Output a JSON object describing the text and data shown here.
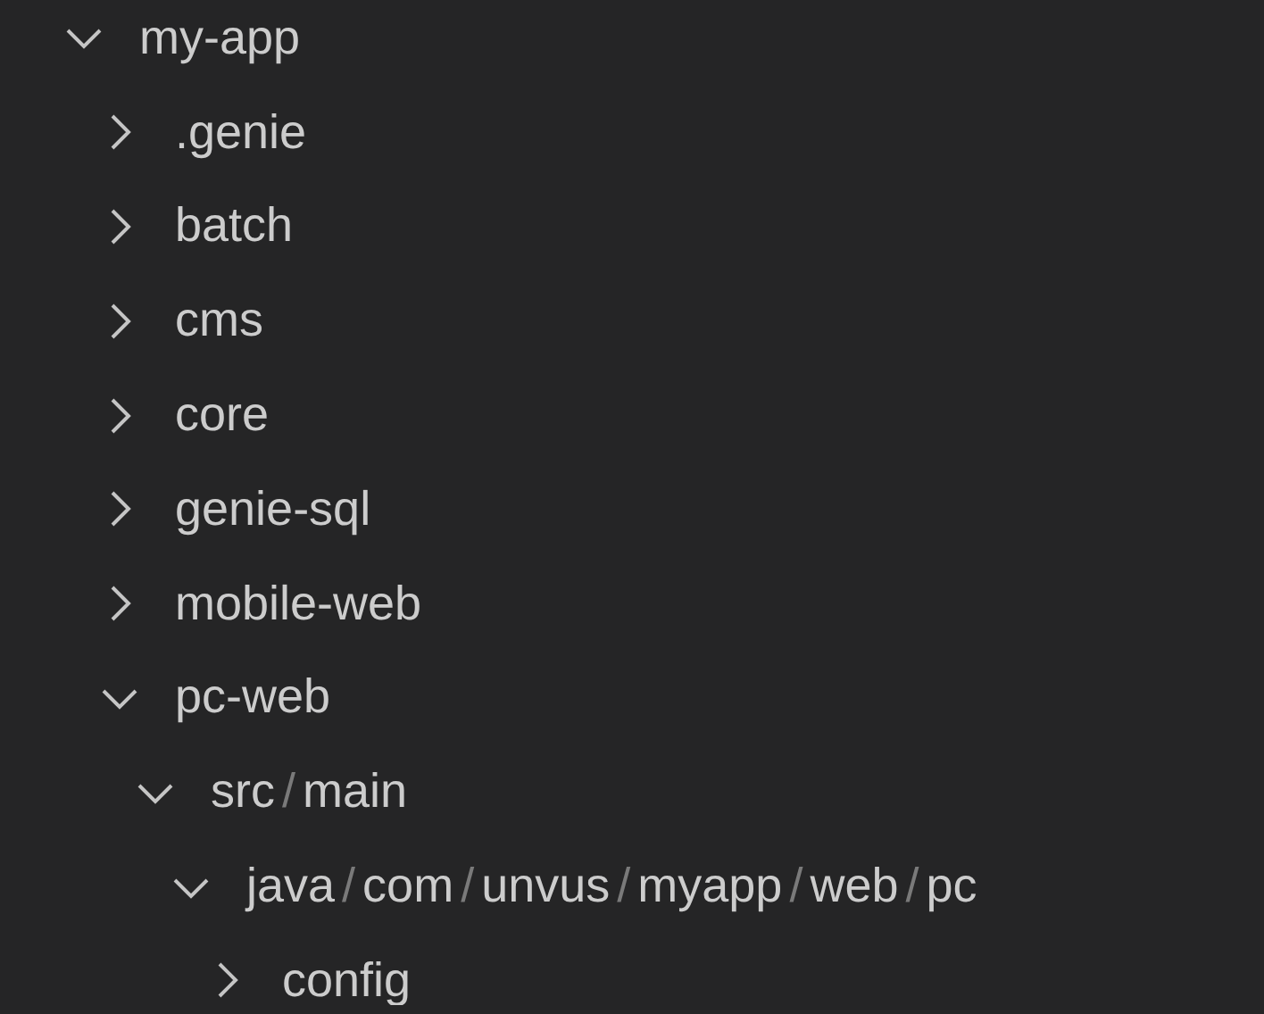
{
  "tree": [
    {
      "segments": [
        "my-app"
      ],
      "expanded": true,
      "children": [
        {
          "segments": [
            ".genie"
          ],
          "expanded": false
        },
        {
          "segments": [
            "batch"
          ],
          "expanded": false
        },
        {
          "segments": [
            "cms"
          ],
          "expanded": false
        },
        {
          "segments": [
            "core"
          ],
          "expanded": false
        },
        {
          "segments": [
            "genie-sql"
          ],
          "expanded": false
        },
        {
          "segments": [
            "mobile-web"
          ],
          "expanded": false
        },
        {
          "segments": [
            "pc-web"
          ],
          "expanded": true,
          "children": [
            {
              "segments": [
                "src",
                "main"
              ],
              "separator": "/",
              "expanded": true,
              "children": [
                {
                  "segments": [
                    "java",
                    "com",
                    "unvus",
                    "myapp",
                    "web",
                    "pc"
                  ],
                  "separator": "/",
                  "expanded": true,
                  "children": [
                    {
                      "segments": [
                        "config"
                      ],
                      "expanded": false
                    }
                  ]
                }
              ]
            }
          ]
        }
      ]
    }
  ]
}
